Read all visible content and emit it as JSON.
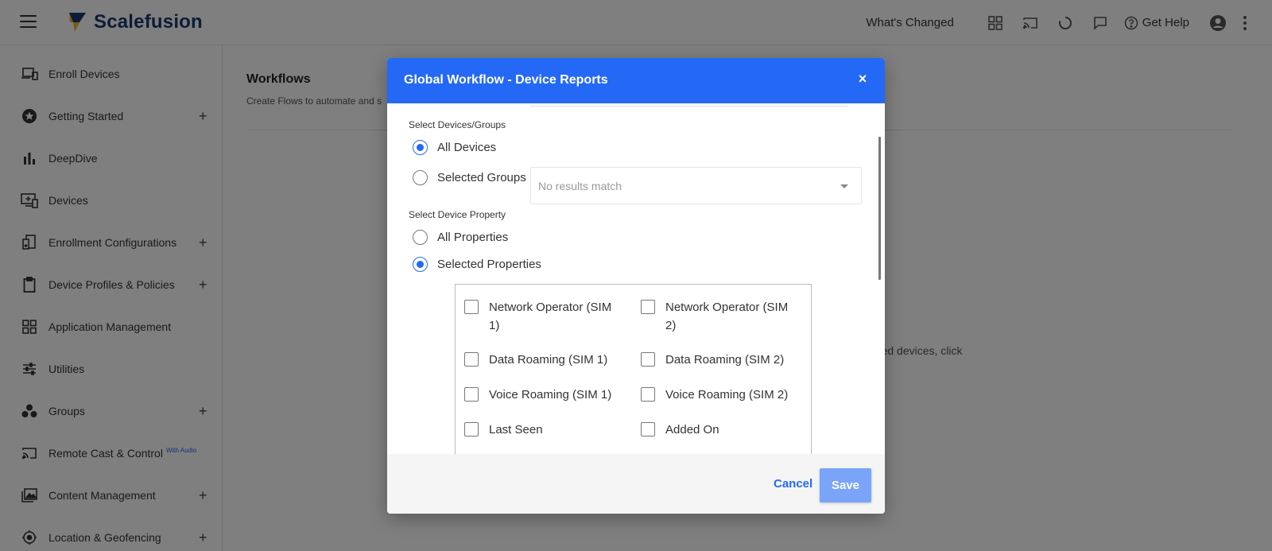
{
  "app": {
    "brand_name": "Scalefusion",
    "menu_icon": "hamburger-menu-icon",
    "brand_color": "#1a3a6e",
    "accent_color": "#2469f5"
  },
  "topbar": {
    "whats_changed": "What's Changed",
    "get_help": "Get Help",
    "icons": [
      "apps-grid-icon",
      "cast-icon",
      "loading-circle-icon",
      "chat-icon",
      "help-circle-icon",
      "account-circle-icon",
      "more-vertical-icon"
    ]
  },
  "sidebar": {
    "items": [
      {
        "label": "Enroll Devices",
        "icon": "enroll-devices-icon",
        "expandable": false
      },
      {
        "label": "Getting Started",
        "icon": "star-badge-icon",
        "expandable": true
      },
      {
        "label": "DeepDive",
        "icon": "bar-chart-icon",
        "expandable": false
      },
      {
        "label": "Devices",
        "icon": "devices-icon",
        "expandable": false
      },
      {
        "label": "Enrollment Configurations",
        "icon": "enrollment-config-icon",
        "expandable": true
      },
      {
        "label": "Device Profiles & Policies",
        "icon": "clipboard-icon",
        "expandable": true
      },
      {
        "label": "Application Management",
        "icon": "apps-grid-icon",
        "expandable": false
      },
      {
        "label": "Utilities",
        "icon": "sliders-icon",
        "expandable": false
      },
      {
        "label": "Groups",
        "icon": "groups-icon",
        "expandable": true
      },
      {
        "label": "Remote Cast & Control",
        "icon": "cast-icon",
        "expandable": false,
        "badge": "With Audio"
      },
      {
        "label": "Content Management",
        "icon": "photo-library-icon",
        "expandable": true
      },
      {
        "label": "Location & Geofencing",
        "icon": "location-pin-icon",
        "expandable": true
      }
    ],
    "plus_symbol": "+"
  },
  "main": {
    "title": "Workflows",
    "subtitle": "Create Flows to automate and s",
    "background_text": "aged devices, click"
  },
  "modal": {
    "title": "Global Workflow - Device Reports",
    "close_symbol": "×",
    "devices_section_label": "Select Devices/Groups",
    "devices_options": [
      {
        "label": "All Devices",
        "checked": true
      },
      {
        "label": "Selected Groups",
        "checked": false
      }
    ],
    "groups_select": {
      "text": "No results match"
    },
    "property_section_label": "Select Device Property",
    "property_options": [
      {
        "label": "All Properties",
        "checked": false
      },
      {
        "label": "Selected Properties",
        "checked": true
      }
    ],
    "properties": [
      {
        "label": "Network Operator (SIM 1)",
        "checked": false
      },
      {
        "label": "Network Operator (SIM 2)",
        "checked": false
      },
      {
        "label": "Data Roaming (SIM 1)",
        "checked": false
      },
      {
        "label": "Data Roaming (SIM 2)",
        "checked": false
      },
      {
        "label": "Voice Roaming (SIM 1)",
        "checked": false
      },
      {
        "label": "Voice Roaming (SIM 2)",
        "checked": false
      },
      {
        "label": "Last Seen",
        "checked": false
      },
      {
        "label": "Added On",
        "checked": false
      }
    ],
    "cancel_label": "Cancel",
    "save_label": "Save"
  }
}
